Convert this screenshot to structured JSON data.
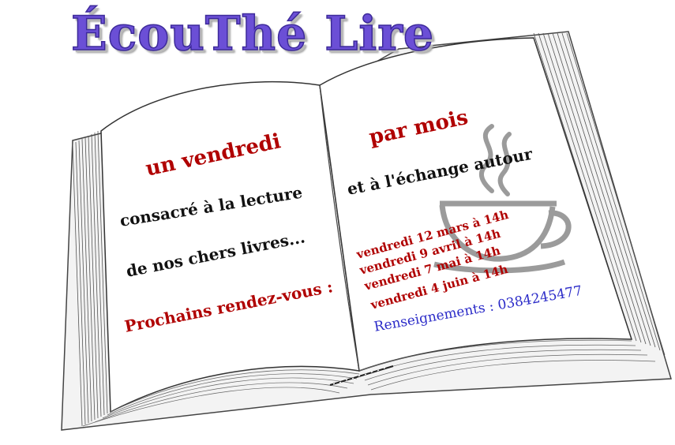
{
  "title": "ÉcouThé Lire",
  "left_page": {
    "line1": "un vendredi",
    "line2": "consacré  à la lecture",
    "line3": "de nos chers livres...",
    "line4": "Prochains rendez-vous :"
  },
  "right_page": {
    "line1": "par mois",
    "line2": "et à l'échange autour",
    "dates": [
      "vendredi 12 mars à 14h",
      "vendredi 9 avril à 14h",
      "vendredi 7 mai à 14h",
      "vendredi 4 juin à 14h"
    ],
    "contact": "Renseignements : 0384245477"
  },
  "icons": {
    "book": "open-book-illustration",
    "cup": "teacup-icon"
  },
  "colors": {
    "title": "#6b4fd6",
    "accent_red": "#b00000",
    "contact_blue": "#2b2bc8",
    "text": "#111111"
  }
}
